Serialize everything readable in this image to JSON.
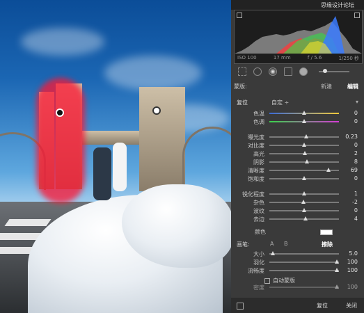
{
  "app": {
    "watermark": "思缘设计论坛",
    "corner_text": "直方图"
  },
  "histogram": {
    "iso": "ISO 100",
    "focal": "17 mm",
    "aperture": "f / 5.6",
    "shutter": "1/250 秒",
    "colors": {
      "blue": "#3b7bff",
      "green": "#39d34a",
      "red": "#ff3a3a",
      "yellow": "#f2e12b",
      "gray": "#b9b9b9"
    }
  },
  "mask_header": {
    "label": "蒙版:",
    "new_label": "新建",
    "edit_label": "编辑"
  },
  "effect": {
    "label": "复位",
    "preset": "自定 ÷"
  },
  "sliders": [
    {
      "name": "色温",
      "value": "0",
      "pos": 0.5
    },
    {
      "name": "色调",
      "value": "0",
      "pos": 0.5
    },
    {
      "name": "曝光度",
      "value": "0.23",
      "pos": 0.53
    },
    {
      "name": "对比度",
      "value": "0",
      "pos": 0.5
    },
    {
      "name": "高光",
      "value": "2",
      "pos": 0.51
    },
    {
      "name": "阴影",
      "value": "8",
      "pos": 0.54
    },
    {
      "name": "清晰度",
      "value": "69",
      "pos": 0.85
    },
    {
      "name": "饱和度",
      "value": "0",
      "pos": 0.5
    },
    {
      "name": "锐化程度",
      "value": "1",
      "pos": 0.5
    },
    {
      "name": "杂色",
      "value": "-2",
      "pos": 0.49
    },
    {
      "name": "波纹",
      "value": "0",
      "pos": 0.5
    },
    {
      "name": "去边",
      "value": "4",
      "pos": 0.52
    }
  ],
  "color": {
    "label": "颜色"
  },
  "brush": {
    "label": "画笔:",
    "a": "A",
    "b": "B",
    "erase": "擦除"
  },
  "brush_sliders": [
    {
      "name": "大小",
      "value": "5.0",
      "pos": 0.03
    },
    {
      "name": "羽化",
      "value": "100",
      "pos": 1.0
    },
    {
      "name": "流畅度",
      "value": "100",
      "pos": 1.0
    }
  ],
  "auto_mask": {
    "label": "自动蒙版"
  },
  "density": {
    "name": "密度",
    "value": "100",
    "pos": 1.0
  },
  "bottom": {
    "reset": "复位",
    "close": "关闭"
  }
}
